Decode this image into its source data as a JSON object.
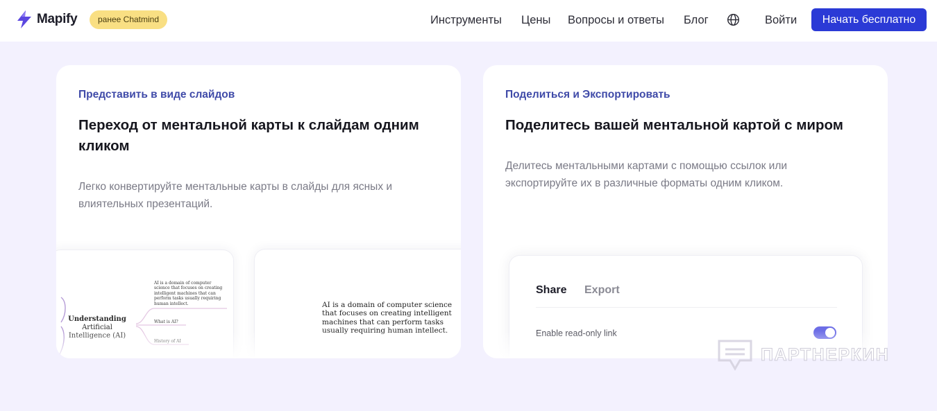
{
  "header": {
    "logo_text": "Mapify",
    "badge": "ранее Chatmind",
    "nav": {
      "tools": "Инструменты",
      "prices": "Цены",
      "faq": "Вопросы и ответы",
      "blog": "Блог"
    },
    "login": "Войти",
    "cta": "Начать бесплатно",
    "colors": {
      "cta": "#2b3ad6",
      "badge": "#f9df83"
    }
  },
  "card_slides": {
    "eyebrow": "Представить в виде слайдов",
    "title": "Переход от ментальной карты к слайдам одним кликом",
    "description": "Легко конвертируйте ментальные карты в слайды для ясных и влиятельных презентаций.",
    "mindmap": {
      "root_line1": "Understanding",
      "root_line2": "Artificial",
      "root_line3": "Intelligence (AI)",
      "node_main": "AI is a domain of computer science that focuses on creating intelligent machines that can perform tasks usually requiring human intellect.",
      "node_2": "What is AI?",
      "node_3": "History of AI"
    },
    "slide_text": "AI is a domain of computer science that focuses on creating intelligent machines that can perform tasks usually requiring human intellect."
  },
  "card_share": {
    "eyebrow": "Поделиться и Экспортировать",
    "title": "Поделитесь вашей ментальной картой с миром",
    "description": "Делитесь ментальными картами с помощью ссылок или экспортируйте их в различные форматы одним кликом.",
    "panel": {
      "tab_share": "Share",
      "tab_export": "Export",
      "setting_label": "Enable read-only link",
      "toggle_on": true
    }
  },
  "watermark": {
    "text": "ПАРТНЕРКИН"
  }
}
